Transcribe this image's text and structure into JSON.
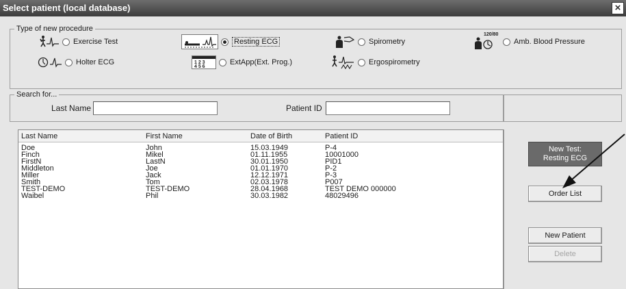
{
  "window": {
    "title": "Select patient (local database)"
  },
  "procedure": {
    "legend": "Type of new procedure",
    "options": [
      {
        "label": "Exercise Test",
        "icon": "exercise-ecg-icon",
        "selected": false
      },
      {
        "label": "Resting ECG",
        "icon": "resting-ecg-icon",
        "selected": true
      },
      {
        "label": "Spirometry",
        "icon": "spirometry-icon",
        "selected": false
      },
      {
        "label": "Amb. Blood Pressure",
        "icon": "blood-pressure-icon",
        "icon_text": "120/80",
        "selected": false
      },
      {
        "label": "Holter ECG",
        "icon": "holter-ecg-icon",
        "selected": false
      },
      {
        "label": "ExtApp(Ext. Prog.)",
        "icon": "ext-app-icon",
        "selected": false
      },
      {
        "label": "Ergospirometry",
        "icon": "ergospirometry-icon",
        "selected": false
      }
    ]
  },
  "search": {
    "legend": "Search for...",
    "last_name_label": "Last Name",
    "last_name_value": "",
    "patient_id_label": "Patient ID",
    "patient_id_value": ""
  },
  "patients": {
    "columns": [
      "Last Name",
      "First Name",
      "Date of Birth",
      "Patient ID"
    ],
    "rows": [
      [
        "Doe",
        "John",
        "15.03.1949",
        "P-4"
      ],
      [
        "Finch",
        "Mikel",
        "01.11.1955",
        "10001000"
      ],
      [
        "FirstN",
        "LastN",
        "30.01.1950",
        "PID1"
      ],
      [
        "Middleton",
        "Joe",
        "01.01.1970",
        "P-2"
      ],
      [
        "Miller",
        "Jack",
        "12.12.1971",
        "P-3"
      ],
      [
        "Smith",
        "Tom",
        "02.03.1978",
        "P007"
      ],
      [
        "TEST-DEMO",
        "TEST-DEMO",
        "28.04.1968",
        "TEST DEMO 000000"
      ],
      [
        "Waibel",
        "Phil",
        "30.03.1982",
        "48029496"
      ]
    ]
  },
  "buttons": {
    "new_test_line1": "New Test:",
    "new_test_line2": "Resting ECG",
    "order_list": "Order List",
    "new_patient": "New Patient",
    "delete": "Delete"
  }
}
